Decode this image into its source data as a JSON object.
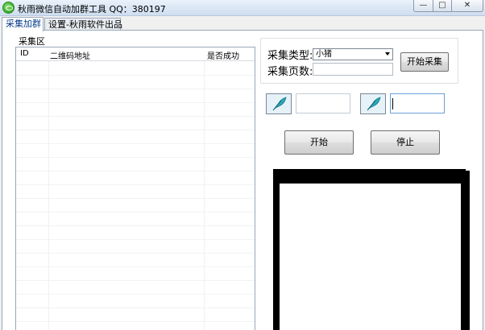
{
  "window": {
    "title": "秋雨微信自动加群工具 QQ：380197",
    "controls": {
      "minimize": "—",
      "maximize": "□",
      "close": "✕"
    }
  },
  "tabs": [
    {
      "label": "采集加群",
      "active": true
    },
    {
      "label": "设置-秋雨软件出品",
      "active": false
    }
  ],
  "collect_area": {
    "group_label": "采集区",
    "columns": [
      "ID",
      "二维码地址",
      "是否成功"
    ],
    "rows": []
  },
  "collect_form": {
    "type_label": "采集类型:",
    "type_value": "小猪",
    "pages_label": "采集页数:",
    "pages_value": "",
    "collect_button": "开始采集"
  },
  "fields": {
    "field_1_value": "",
    "field_2_value": ""
  },
  "actions": {
    "start": "开始",
    "stop": "停止"
  },
  "icons": {
    "app": "wechat-icon",
    "quill": "quill-icon"
  }
}
